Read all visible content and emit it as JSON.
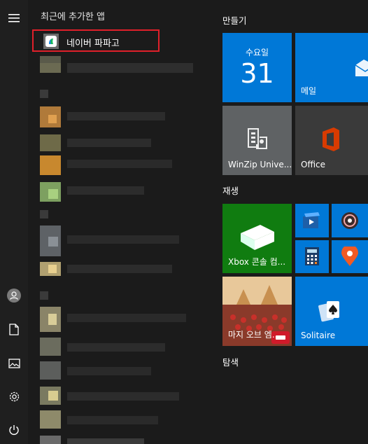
{
  "rail": {
    "items": [
      "menu-icon",
      "user-icon",
      "document-icon",
      "pictures-icon",
      "settings-icon",
      "power-icon"
    ]
  },
  "app_list": {
    "section_title": "최근에 추가한 앱",
    "recent": {
      "label": "네이버 파파고",
      "icon": "papago-icon"
    }
  },
  "tiles": {
    "group1_title": "만들기",
    "calendar": {
      "day_name": "수요일",
      "day_number": "31"
    },
    "mail": {
      "label": "메일"
    },
    "winzip": {
      "label": "WinZip Unive..."
    },
    "office": {
      "label": "Office"
    },
    "group2_title": "재생",
    "xbox": {
      "label": "Xbox 콘솔 컴..."
    },
    "game": {
      "label": "마지 오브 엠..."
    },
    "solitaire": {
      "label": "Solitaire"
    },
    "group3_title": "탐색"
  },
  "colors": {
    "accent": "#0078d7",
    "xbox_green": "#107c10",
    "tile_gray": "#5f6264",
    "highlight_border": "#e0202a"
  }
}
